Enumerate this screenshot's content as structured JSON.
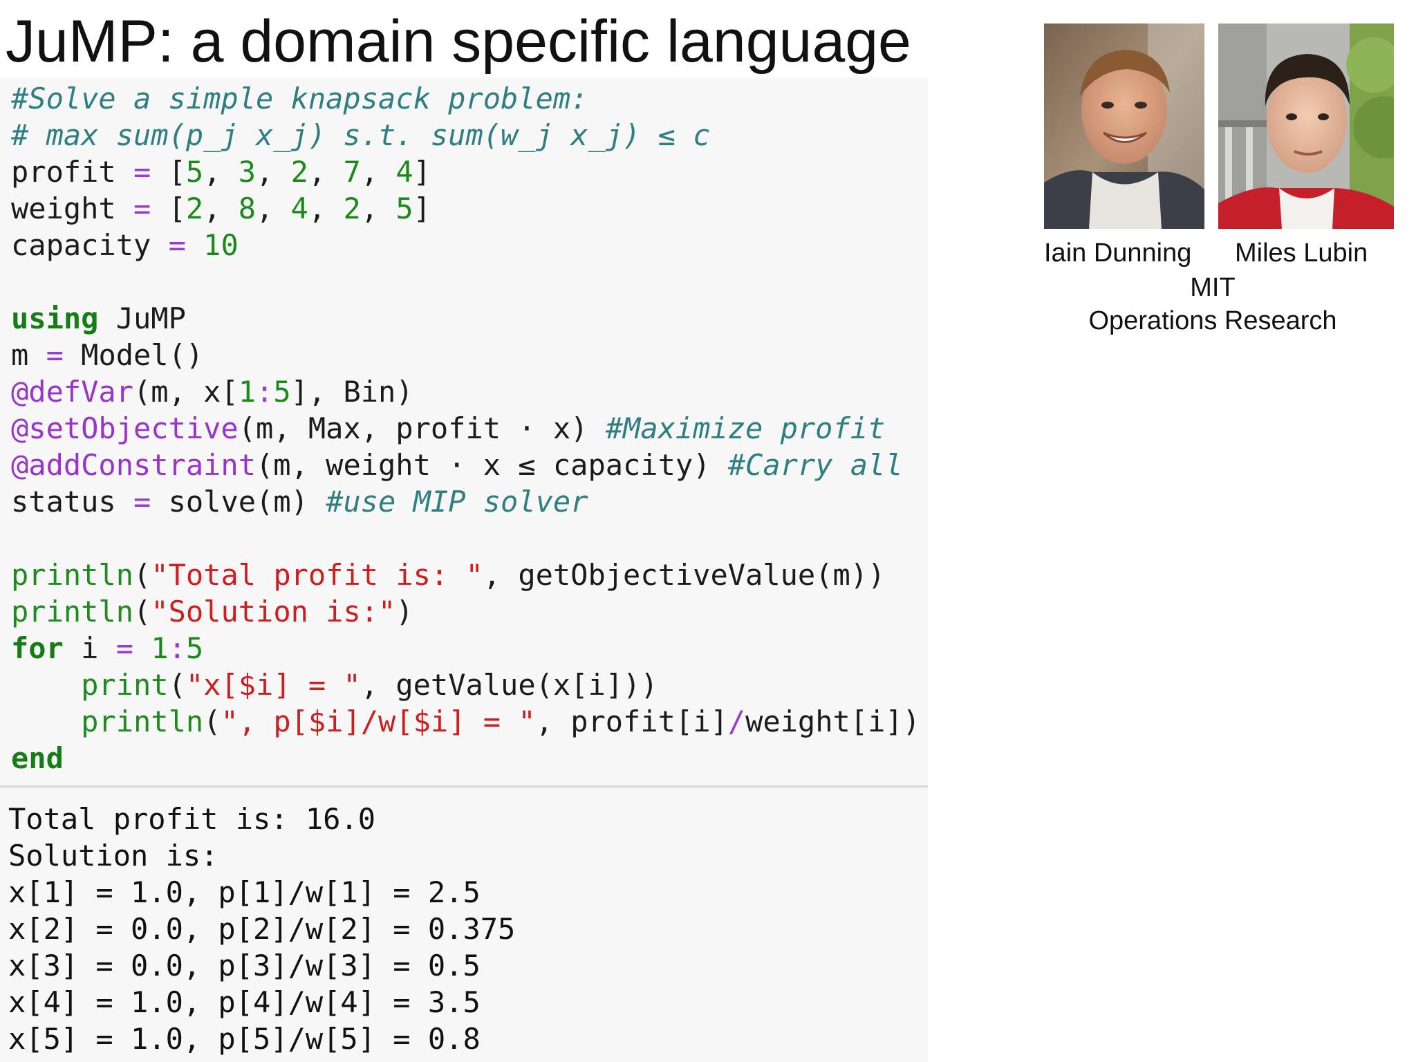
{
  "title": "JuMP: a domain specific language",
  "code_lines": [
    [
      {
        "c": "comment",
        "t": "#Solve a simple knapsack problem:"
      }
    ],
    [
      {
        "c": "comment",
        "t": "# max sum(p_j x_j) s.t. sum(w_j x_j) ≤ c"
      }
    ],
    [
      {
        "c": "",
        "t": "profit "
      },
      {
        "c": "op",
        "t": "="
      },
      {
        "c": "",
        "t": " ["
      },
      {
        "c": "num",
        "t": "5"
      },
      {
        "c": "",
        "t": ", "
      },
      {
        "c": "num",
        "t": "3"
      },
      {
        "c": "",
        "t": ", "
      },
      {
        "c": "num",
        "t": "2"
      },
      {
        "c": "",
        "t": ", "
      },
      {
        "c": "num",
        "t": "7"
      },
      {
        "c": "",
        "t": ", "
      },
      {
        "c": "num",
        "t": "4"
      },
      {
        "c": "",
        "t": "]"
      }
    ],
    [
      {
        "c": "",
        "t": "weight "
      },
      {
        "c": "op",
        "t": "="
      },
      {
        "c": "",
        "t": " ["
      },
      {
        "c": "num",
        "t": "2"
      },
      {
        "c": "",
        "t": ", "
      },
      {
        "c": "num",
        "t": "8"
      },
      {
        "c": "",
        "t": ", "
      },
      {
        "c": "num",
        "t": "4"
      },
      {
        "c": "",
        "t": ", "
      },
      {
        "c": "num",
        "t": "2"
      },
      {
        "c": "",
        "t": ", "
      },
      {
        "c": "num",
        "t": "5"
      },
      {
        "c": "",
        "t": "]"
      }
    ],
    [
      {
        "c": "",
        "t": "capacity "
      },
      {
        "c": "op",
        "t": "="
      },
      {
        "c": "",
        "t": " "
      },
      {
        "c": "num",
        "t": "10"
      }
    ],
    [],
    [
      {
        "c": "kw",
        "t": "using"
      },
      {
        "c": "",
        "t": " JuMP"
      }
    ],
    [
      {
        "c": "",
        "t": "m "
      },
      {
        "c": "op",
        "t": "="
      },
      {
        "c": "",
        "t": " Model()"
      }
    ],
    [
      {
        "c": "macro",
        "t": "@defVar"
      },
      {
        "c": "",
        "t": "(m, x["
      },
      {
        "c": "num",
        "t": "1"
      },
      {
        "c": "op",
        "t": ":"
      },
      {
        "c": "num",
        "t": "5"
      },
      {
        "c": "",
        "t": "], Bin)"
      }
    ],
    [
      {
        "c": "macro",
        "t": "@setObjective"
      },
      {
        "c": "",
        "t": "(m, Max, profit · x) "
      },
      {
        "c": "comment",
        "t": "#Maximize profit"
      }
    ],
    [
      {
        "c": "macro",
        "t": "@addConstraint"
      },
      {
        "c": "",
        "t": "(m, weight · x ≤ capacity) "
      },
      {
        "c": "comment",
        "t": "#Carry all"
      }
    ],
    [
      {
        "c": "",
        "t": "status "
      },
      {
        "c": "op",
        "t": "="
      },
      {
        "c": "",
        "t": " solve(m) "
      },
      {
        "c": "comment",
        "t": "#use MIP solver"
      }
    ],
    [],
    [
      {
        "c": "fn",
        "t": "println"
      },
      {
        "c": "",
        "t": "("
      },
      {
        "c": "str",
        "t": "\"Total profit is: \""
      },
      {
        "c": "",
        "t": ", getObjectiveValue(m))"
      }
    ],
    [
      {
        "c": "fn",
        "t": "println"
      },
      {
        "c": "",
        "t": "("
      },
      {
        "c": "str",
        "t": "\"Solution is:\""
      },
      {
        "c": "",
        "t": ")"
      }
    ],
    [
      {
        "c": "kw",
        "t": "for"
      },
      {
        "c": "",
        "t": " i "
      },
      {
        "c": "op",
        "t": "="
      },
      {
        "c": "",
        "t": " "
      },
      {
        "c": "num",
        "t": "1"
      },
      {
        "c": "op",
        "t": ":"
      },
      {
        "c": "num",
        "t": "5"
      }
    ],
    [
      {
        "c": "",
        "t": "    "
      },
      {
        "c": "fn",
        "t": "print"
      },
      {
        "c": "",
        "t": "("
      },
      {
        "c": "str",
        "t": "\"x[$i] = \""
      },
      {
        "c": "",
        "t": ", getValue(x[i]))"
      }
    ],
    [
      {
        "c": "",
        "t": "    "
      },
      {
        "c": "fn",
        "t": "println"
      },
      {
        "c": "",
        "t": "("
      },
      {
        "c": "str",
        "t": "\", p[$i]/w[$i] = \""
      },
      {
        "c": "",
        "t": ", profit[i]"
      },
      {
        "c": "op",
        "t": "/"
      },
      {
        "c": "",
        "t": "weight[i])"
      }
    ],
    [
      {
        "c": "kw",
        "t": "end"
      }
    ]
  ],
  "output_lines": [
    "Total profit is: 16.0",
    "Solution is:",
    "x[1] = 1.0, p[1]/w[1] = 2.5",
    "x[2] = 0.0, p[2]/w[2] = 0.375",
    "x[3] = 0.0, p[3]/w[3] = 0.5",
    "x[4] = 1.0, p[4]/w[4] = 3.5",
    "x[5] = 1.0, p[5]/w[5] = 0.8"
  ],
  "people": {
    "iain_name": "Iain Dunning",
    "miles_name": "Miles Lubin",
    "institution": "MIT",
    "department": "Operations Research"
  },
  "icons": [
    "portrait-photo-iain",
    "portrait-photo-miles"
  ],
  "colors": {
    "comment": "#2f7f82",
    "number": "#1a8a1a",
    "operator": "#9a3bd1",
    "keyword": "#167c16",
    "macro": "#9a33c9",
    "string": "#cc1f1f",
    "panel_background": "#f7f7f7"
  }
}
